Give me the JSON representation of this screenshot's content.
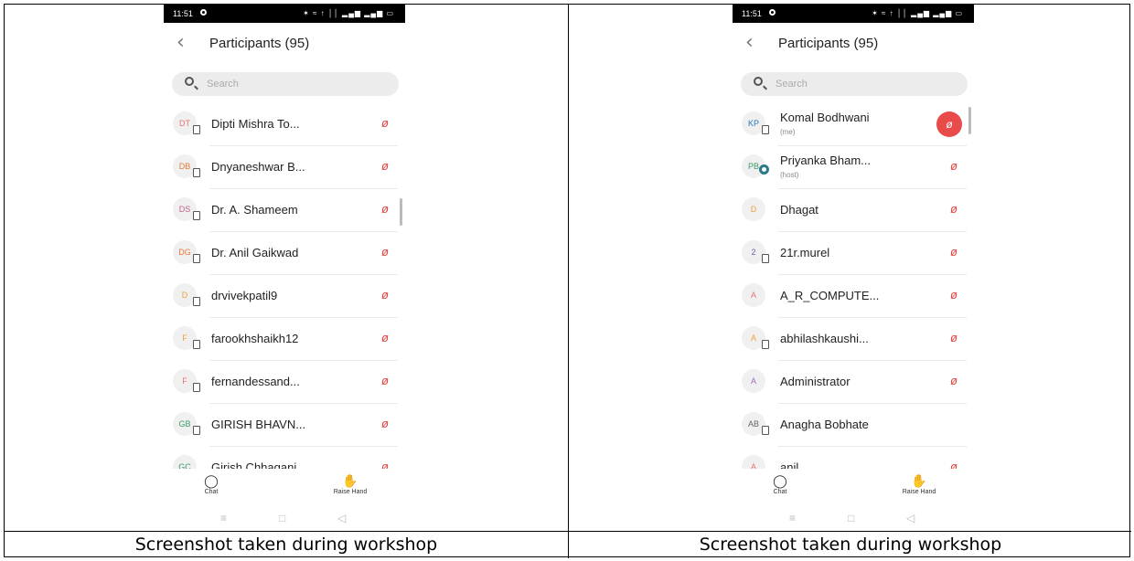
{
  "caption": "Screenshot taken during workshop",
  "status": {
    "time": "11:51",
    "icons": "✶ ≈ ↑ ││ ▂▄▆ ▂▄▆ ▭"
  },
  "header": {
    "title": "Participants (95)"
  },
  "search": {
    "placeholder": "Search"
  },
  "bottom": {
    "chat": "Chat",
    "raise_hand": "Raise Hand"
  },
  "colors": {
    "mic": "#e04444",
    "accent_red": "#e94a4a"
  },
  "left_list": [
    {
      "initials": "DT",
      "name": "Dipti Mishra To...",
      "color": "#e57373"
    },
    {
      "initials": "DB",
      "name": "Dnyaneshwar B...",
      "color": "#e57a3b"
    },
    {
      "initials": "DS",
      "name": "Dr. A. Shameem",
      "color": "#c06090"
    },
    {
      "initials": "DG",
      "name": "Dr. Anil Gaikwad",
      "color": "#e57a3b"
    },
    {
      "initials": "D",
      "name": "drvivekpatil9",
      "color": "#e8a23a"
    },
    {
      "initials": "F",
      "name": "farookhshaikh12",
      "color": "#e8a23a"
    },
    {
      "initials": "F",
      "name": "fernandessand...",
      "color": "#e57373"
    },
    {
      "initials": "GB",
      "name": "GIRISH BHAVN...",
      "color": "#3a9a6a"
    },
    {
      "initials": "GC",
      "name": "Girish Chhagani",
      "color": "#3a9a6a"
    }
  ],
  "right_list": [
    {
      "initials": "KP",
      "name": "Komal Bodhwani",
      "sub": "(me)",
      "color": "#2a7ab8"
    },
    {
      "initials": "PB",
      "name": "Priyanka Bham...",
      "sub": "(host)",
      "color": "#3a9a6a"
    },
    {
      "initials": "D",
      "name": "Dhagat",
      "color": "#e8a23a"
    },
    {
      "initials": "2",
      "name": "21r.murel",
      "color": "#7a5ab8"
    },
    {
      "initials": "A",
      "name": "A_R_COMPUTE...",
      "color": "#e57373"
    },
    {
      "initials": "A",
      "name": "abhilashkaushi...",
      "color": "#e8a23a"
    },
    {
      "initials": "A",
      "name": "Administrator",
      "color": "#9a6ab8"
    },
    {
      "initials": "AB",
      "name": "Anagha Bobhate",
      "color": "#666"
    },
    {
      "initials": "A",
      "name": "anil",
      "color": "#e57373"
    }
  ]
}
